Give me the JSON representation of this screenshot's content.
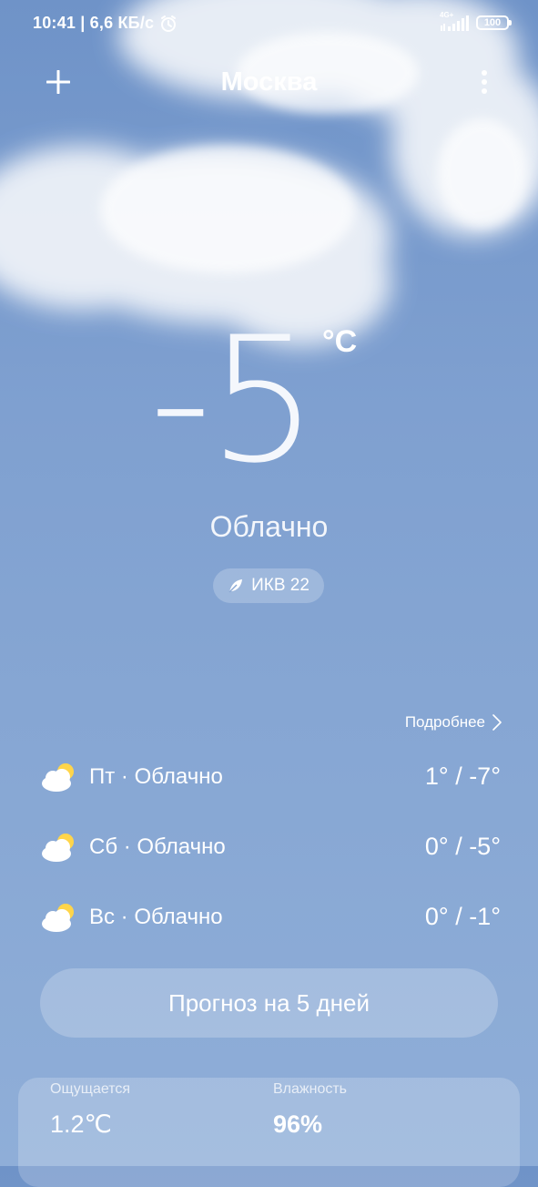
{
  "status_bar": {
    "time_and_speed": "10:41 | 6,6 КБ/с",
    "network": "4G+",
    "battery": "100"
  },
  "header": {
    "city": "Москва"
  },
  "current": {
    "temperature": "-5",
    "unit": "°C",
    "condition": "Облачно",
    "aqi": "ИКВ 22"
  },
  "forecast": {
    "details_label": "Подробнее",
    "days": [
      {
        "label": "Пт · Облачно",
        "temp": "1° / -7°",
        "icon": "partly-cloudy-icon"
      },
      {
        "label": "Сб · Облачно",
        "temp": "0° / -5°",
        "icon": "partly-cloudy-icon"
      },
      {
        "label": "Вс · Облачно",
        "temp": "0° / -1°",
        "icon": "partly-cloudy-icon"
      }
    ]
  },
  "five_day_button": "Прогноз на 5 дней",
  "details_card": {
    "feels_like_label": "Ощущается",
    "feels_like_value": "1.2℃",
    "humidity_label": "Влажность",
    "humidity_value": "96%"
  }
}
